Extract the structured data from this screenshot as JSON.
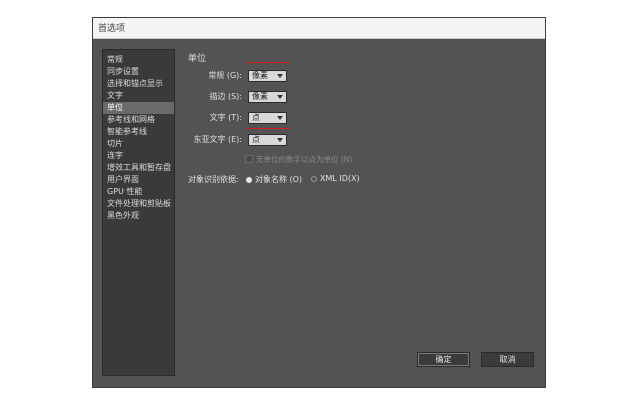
{
  "dialog": {
    "title": "首选项"
  },
  "sidebar": {
    "items": [
      {
        "label": "常规"
      },
      {
        "label": "同步设置"
      },
      {
        "label": "选择和锚点显示"
      },
      {
        "label": "文字"
      },
      {
        "label": "单位",
        "active": true
      },
      {
        "label": "参考线和网格"
      },
      {
        "label": "智能参考线"
      },
      {
        "label": "切片"
      },
      {
        "label": "连字"
      },
      {
        "label": "增效工具和暂存盘"
      },
      {
        "label": "用户界面"
      },
      {
        "label": "GPU 性能"
      },
      {
        "label": "文件处理和剪贴板"
      },
      {
        "label": "黑色外观"
      }
    ]
  },
  "units": {
    "section_title": "单位",
    "general": {
      "label": "常规 (G):",
      "value": "像素"
    },
    "stroke": {
      "label": "描边 (S):",
      "value": "像素"
    },
    "type": {
      "label": "文字 (T):",
      "value": "点"
    },
    "east_asian_type": {
      "label": "东亚文字 (E):",
      "value": "点"
    },
    "numbers_without_units": {
      "label": "无单位的数字以点为单位 (N)",
      "checked": false
    },
    "identify_objects": {
      "label": "对象识别依据:",
      "options": [
        {
          "label": "对象名称 (O)",
          "selected": true
        },
        {
          "label": "XML ID(X)",
          "selected": false
        }
      ]
    }
  },
  "buttons": {
    "ok": "确定",
    "cancel": "取消"
  },
  "colors": {
    "highlight_box": "#d21f24",
    "dialog_bg": "#535353",
    "sidebar_bg": "#3a3a3a"
  }
}
